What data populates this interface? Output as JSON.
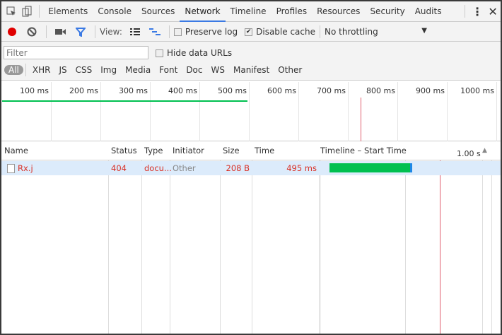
{
  "tabs": [
    "Elements",
    "Console",
    "Sources",
    "Network",
    "Timeline",
    "Profiles",
    "Resources",
    "Security",
    "Audits"
  ],
  "active_tab": "Network",
  "toolbar": {
    "view_label": "View:",
    "preserve_log": "Preserve log",
    "preserve_log_checked": false,
    "disable_cache": "Disable cache",
    "disable_cache_checked": true,
    "throttling": "No throttling"
  },
  "filter": {
    "placeholder": "Filter",
    "hide_data_urls": "Hide data URLs",
    "types": [
      "All",
      "XHR",
      "JS",
      "CSS",
      "Img",
      "Media",
      "Font",
      "Doc",
      "WS",
      "Manifest",
      "Other"
    ],
    "active": "All"
  },
  "overview": {
    "ticks": [
      "100 ms",
      "200 ms",
      "300 ms",
      "400 ms",
      "500 ms",
      "600 ms",
      "700 ms",
      "800 ms",
      "900 ms",
      "1000 ms"
    ]
  },
  "table": {
    "headers": {
      "name": "Name",
      "status": "Status",
      "type": "Type",
      "initiator": "Initiator",
      "size": "Size",
      "time": "Time",
      "timeline": "Timeline – Start Time",
      "scale": "1.00 s"
    },
    "rows": [
      {
        "name": "Rx.j",
        "status": "404",
        "type": "docu...",
        "initiator": "Other",
        "size": "208 B",
        "time": "495 ms"
      }
    ]
  },
  "colors": {
    "error": "#d93025",
    "bar_green": "#00c050",
    "bar_blue": "#1e88e5",
    "accent": "#3b7ae4",
    "record": "#e00000"
  }
}
